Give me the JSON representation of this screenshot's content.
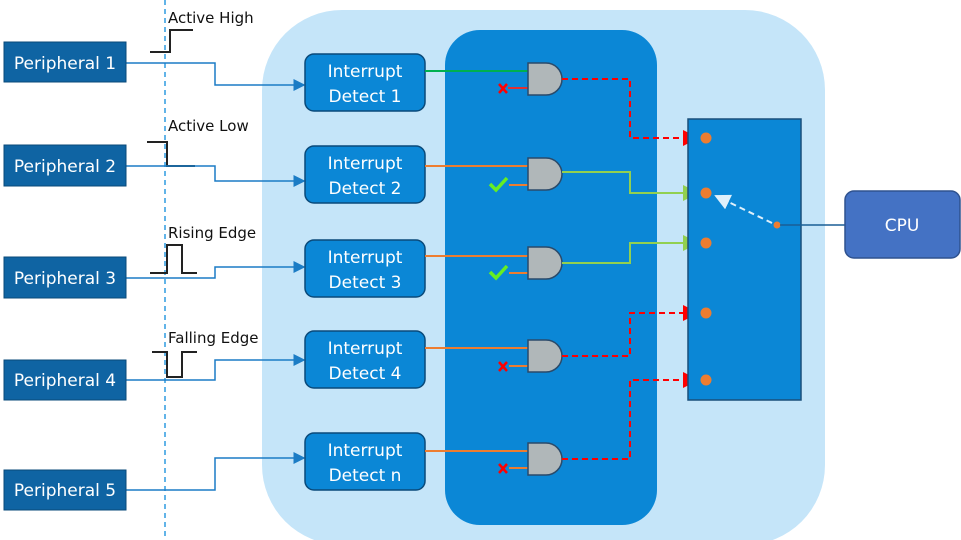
{
  "peripherals": [
    "Peripheral 1",
    "Peripheral 2",
    "Peripheral 3",
    "Peripheral 4",
    "Peripheral 5"
  ],
  "signal_types": [
    "Active High",
    "Active Low",
    "Rising Edge",
    "Falling Edge"
  ],
  "detectors": [
    {
      "line1": "Interrupt",
      "line2": "Detect 1",
      "enable": "disabled"
    },
    {
      "line1": "Interrupt",
      "line2": "Detect 2",
      "enable": "enabled"
    },
    {
      "line1": "Interrupt",
      "line2": "Detect 3",
      "enable": "enabled"
    },
    {
      "line1": "Interrupt",
      "line2": "Detect 4",
      "enable": "disabled"
    },
    {
      "line1": "Interrupt",
      "line2": "Detect n",
      "enable": "disabled"
    }
  ],
  "cpu_label": "CPU",
  "icons": {
    "enabled": "check-icon",
    "disabled": "cross-icon",
    "gate": "and-gate-icon"
  },
  "colors": {
    "peripheral": "#0f64a3",
    "controller_bg": "#c5e5f9",
    "gate_block": "#0b87d6",
    "cpu": "#4472c4",
    "active_path": "#92d050",
    "blocked_path": "#ff0000",
    "input_line": "#ed7d31",
    "mux_dot": "#ed7d31"
  }
}
